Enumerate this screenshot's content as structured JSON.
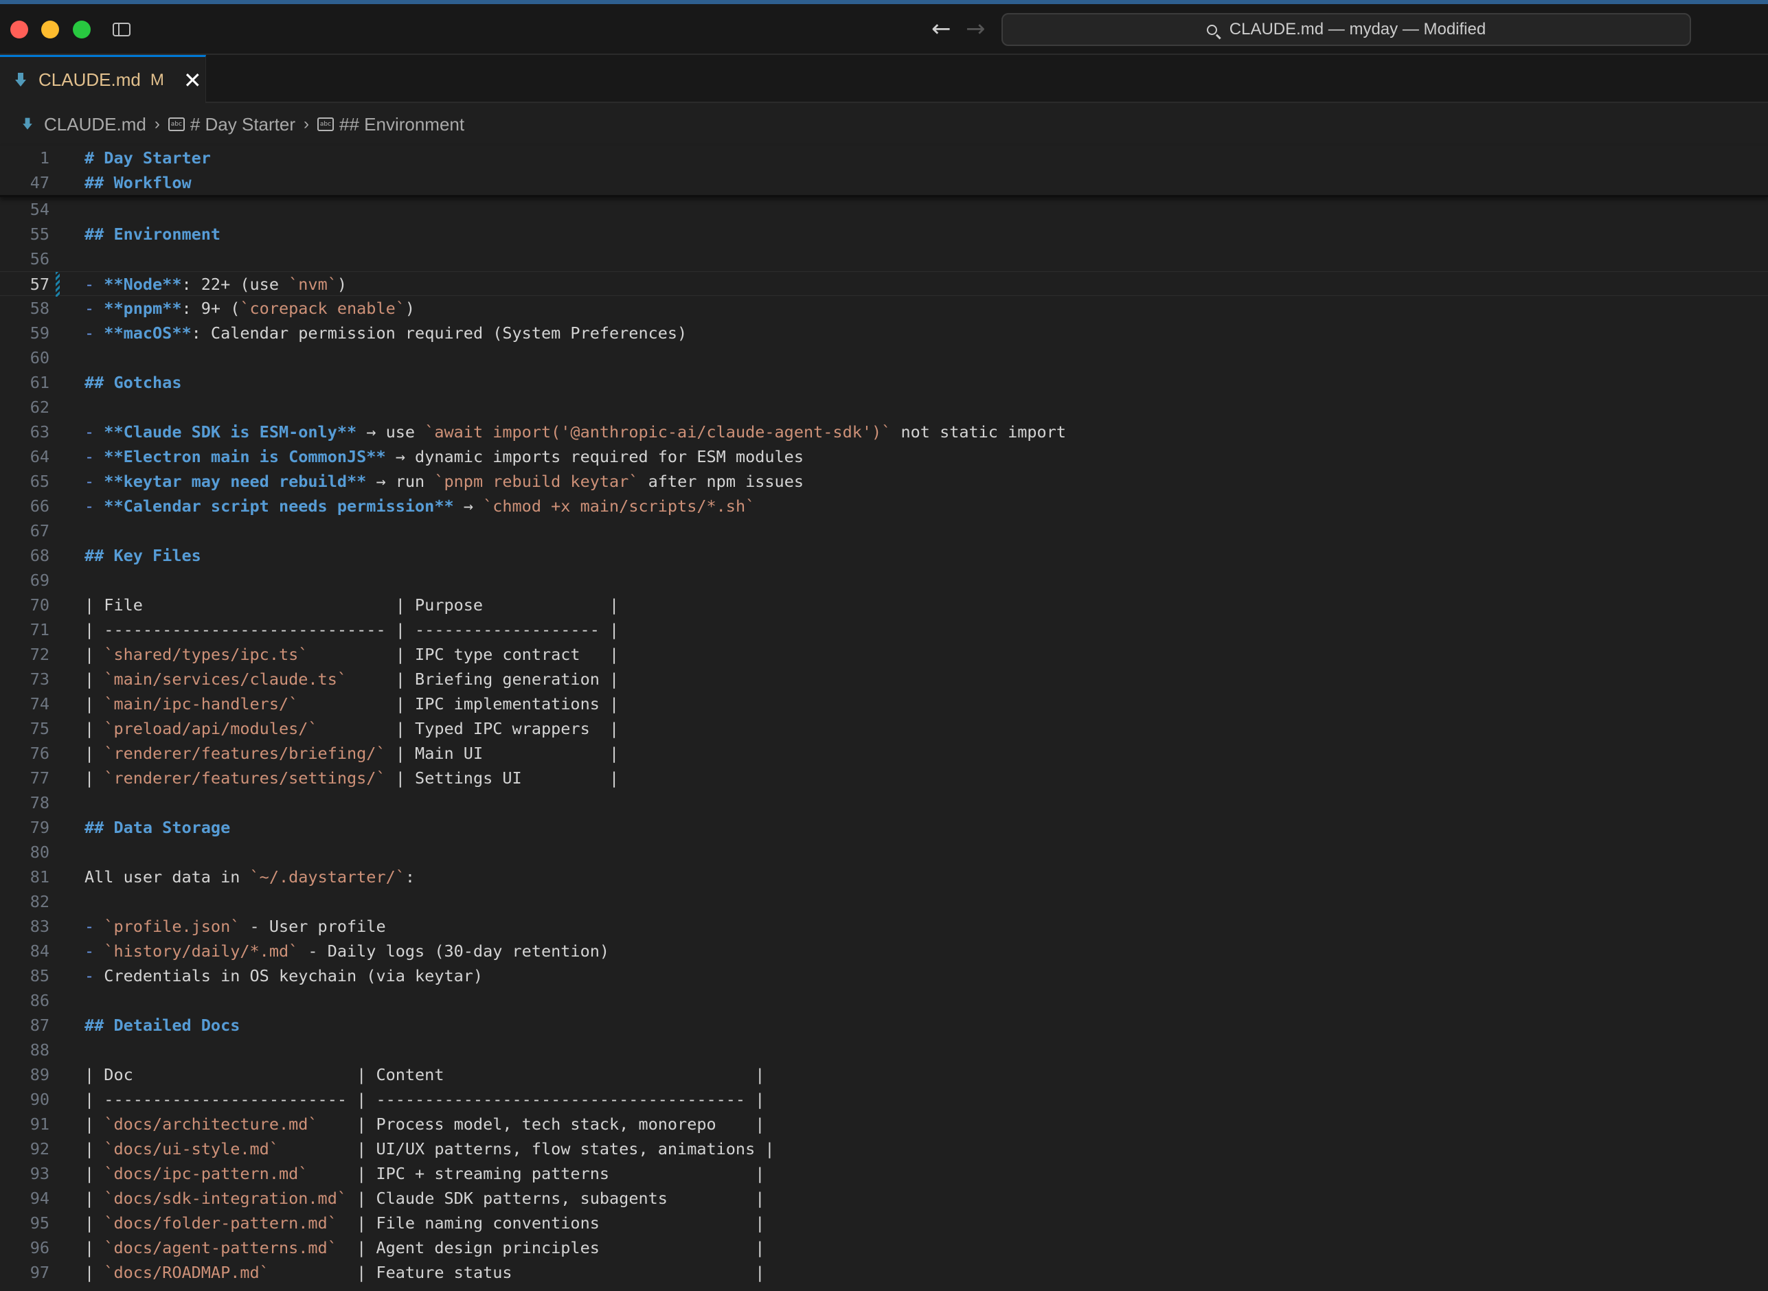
{
  "window": {
    "title": "CLAUDE.md — myday — Modified"
  },
  "tab": {
    "filename": "CLAUDE.md",
    "modified": "M"
  },
  "breadcrumb": {
    "file": "CLAUDE.md",
    "level1": "# Day Starter",
    "level2": "## Environment"
  },
  "sticky_lines": [
    {
      "num": "1",
      "segs": [
        {
          "k": "h",
          "t": "# Day Starter"
        }
      ]
    },
    {
      "num": "47",
      "segs": [
        {
          "k": "h",
          "t": "## Workflow"
        }
      ]
    }
  ],
  "lines": [
    {
      "num": "54",
      "segs": []
    },
    {
      "num": "55",
      "segs": [
        {
          "k": "h",
          "t": "## Environment"
        }
      ]
    },
    {
      "num": "56",
      "segs": []
    },
    {
      "num": "57",
      "active": true,
      "segs": [
        {
          "k": "p",
          "t": "- "
        },
        {
          "k": "b",
          "t": "**Node**"
        },
        {
          "k": "t",
          "t": ": 22+ (use "
        },
        {
          "k": "c",
          "t": "`nvm`"
        },
        {
          "k": "t",
          "t": ")"
        }
      ]
    },
    {
      "num": "58",
      "segs": [
        {
          "k": "p",
          "t": "- "
        },
        {
          "k": "b",
          "t": "**pnpm**"
        },
        {
          "k": "t",
          "t": ": 9+ ("
        },
        {
          "k": "c",
          "t": "`corepack enable`"
        },
        {
          "k": "t",
          "t": ")"
        }
      ]
    },
    {
      "num": "59",
      "segs": [
        {
          "k": "p",
          "t": "- "
        },
        {
          "k": "b",
          "t": "**macOS**"
        },
        {
          "k": "t",
          "t": ": Calendar permission required (System Preferences)"
        }
      ]
    },
    {
      "num": "60",
      "segs": []
    },
    {
      "num": "61",
      "segs": [
        {
          "k": "h",
          "t": "## Gotchas"
        }
      ]
    },
    {
      "num": "62",
      "segs": []
    },
    {
      "num": "63",
      "segs": [
        {
          "k": "p",
          "t": "- "
        },
        {
          "k": "b",
          "t": "**Claude SDK is ESM-only**"
        },
        {
          "k": "t",
          "t": " → use "
        },
        {
          "k": "c",
          "t": "`await import('@anthropic-ai/claude-agent-sdk')`"
        },
        {
          "k": "t",
          "t": " not static import"
        }
      ]
    },
    {
      "num": "64",
      "segs": [
        {
          "k": "p",
          "t": "- "
        },
        {
          "k": "b",
          "t": "**Electron main is CommonJS**"
        },
        {
          "k": "t",
          "t": " → dynamic imports required for ESM modules"
        }
      ]
    },
    {
      "num": "65",
      "segs": [
        {
          "k": "p",
          "t": "- "
        },
        {
          "k": "b",
          "t": "**keytar may need rebuild**"
        },
        {
          "k": "t",
          "t": " → run "
        },
        {
          "k": "c",
          "t": "`pnpm rebuild keytar`"
        },
        {
          "k": "t",
          "t": " after npm issues"
        }
      ]
    },
    {
      "num": "66",
      "segs": [
        {
          "k": "p",
          "t": "- "
        },
        {
          "k": "b",
          "t": "**Calendar script needs permission**"
        },
        {
          "k": "t",
          "t": " → "
        },
        {
          "k": "c",
          "t": "`chmod +x main/scripts/*.sh`"
        }
      ]
    },
    {
      "num": "67",
      "segs": []
    },
    {
      "num": "68",
      "segs": [
        {
          "k": "h",
          "t": "## Key Files"
        }
      ]
    },
    {
      "num": "69",
      "segs": []
    },
    {
      "num": "70",
      "segs": [
        {
          "k": "t",
          "t": "| File                          | Purpose             |"
        }
      ]
    },
    {
      "num": "71",
      "segs": [
        {
          "k": "t",
          "t": "| ----------------------------- | ------------------- |"
        }
      ]
    },
    {
      "num": "72",
      "segs": [
        {
          "k": "t",
          "t": "| "
        },
        {
          "k": "c",
          "t": "`shared/types/ipc.ts`"
        },
        {
          "k": "t",
          "t": "         | IPC type contract   |"
        }
      ]
    },
    {
      "num": "73",
      "segs": [
        {
          "k": "t",
          "t": "| "
        },
        {
          "k": "c",
          "t": "`main/services/claude.ts`"
        },
        {
          "k": "t",
          "t": "     | Briefing generation |"
        }
      ]
    },
    {
      "num": "74",
      "segs": [
        {
          "k": "t",
          "t": "| "
        },
        {
          "k": "c",
          "t": "`main/ipc-handlers/`"
        },
        {
          "k": "t",
          "t": "          | IPC implementations |"
        }
      ]
    },
    {
      "num": "75",
      "segs": [
        {
          "k": "t",
          "t": "| "
        },
        {
          "k": "c",
          "t": "`preload/api/modules/`"
        },
        {
          "k": "t",
          "t": "        | Typed IPC wrappers  |"
        }
      ]
    },
    {
      "num": "76",
      "segs": [
        {
          "k": "t",
          "t": "| "
        },
        {
          "k": "c",
          "t": "`renderer/features/briefing/`"
        },
        {
          "k": "t",
          "t": " | Main UI             |"
        }
      ]
    },
    {
      "num": "77",
      "segs": [
        {
          "k": "t",
          "t": "| "
        },
        {
          "k": "c",
          "t": "`renderer/features/settings/`"
        },
        {
          "k": "t",
          "t": " | Settings UI         |"
        }
      ]
    },
    {
      "num": "78",
      "segs": []
    },
    {
      "num": "79",
      "segs": [
        {
          "k": "h",
          "t": "## Data Storage"
        }
      ]
    },
    {
      "num": "80",
      "segs": []
    },
    {
      "num": "81",
      "segs": [
        {
          "k": "t",
          "t": "All user data in "
        },
        {
          "k": "c",
          "t": "`~/.daystarter/`"
        },
        {
          "k": "t",
          "t": ":"
        }
      ]
    },
    {
      "num": "82",
      "segs": []
    },
    {
      "num": "83",
      "segs": [
        {
          "k": "p",
          "t": "- "
        },
        {
          "k": "c",
          "t": "`profile.json`"
        },
        {
          "k": "t",
          "t": " - User profile"
        }
      ]
    },
    {
      "num": "84",
      "segs": [
        {
          "k": "p",
          "t": "- "
        },
        {
          "k": "c",
          "t": "`history/daily/*.md`"
        },
        {
          "k": "t",
          "t": " - Daily logs (30-day retention)"
        }
      ]
    },
    {
      "num": "85",
      "segs": [
        {
          "k": "p",
          "t": "- "
        },
        {
          "k": "t",
          "t": "Credentials in OS keychain (via keytar)"
        }
      ]
    },
    {
      "num": "86",
      "segs": []
    },
    {
      "num": "87",
      "segs": [
        {
          "k": "h",
          "t": "## Detailed Docs"
        }
      ]
    },
    {
      "num": "88",
      "segs": []
    },
    {
      "num": "89",
      "segs": [
        {
          "k": "t",
          "t": "| Doc                       | Content                                |"
        }
      ]
    },
    {
      "num": "90",
      "segs": [
        {
          "k": "t",
          "t": "| ------------------------- | -------------------------------------- |"
        }
      ]
    },
    {
      "num": "91",
      "segs": [
        {
          "k": "t",
          "t": "| "
        },
        {
          "k": "c",
          "t": "`docs/architecture.md`"
        },
        {
          "k": "t",
          "t": "    | Process model, tech stack, monorepo    |"
        }
      ]
    },
    {
      "num": "92",
      "segs": [
        {
          "k": "t",
          "t": "| "
        },
        {
          "k": "c",
          "t": "`docs/ui-style.md`"
        },
        {
          "k": "t",
          "t": "        | UI/UX patterns, flow states, animations |"
        }
      ]
    },
    {
      "num": "93",
      "segs": [
        {
          "k": "t",
          "t": "| "
        },
        {
          "k": "c",
          "t": "`docs/ipc-pattern.md`"
        },
        {
          "k": "t",
          "t": "     | IPC + streaming patterns               |"
        }
      ]
    },
    {
      "num": "94",
      "segs": [
        {
          "k": "t",
          "t": "| "
        },
        {
          "k": "c",
          "t": "`docs/sdk-integration.md`"
        },
        {
          "k": "t",
          "t": " | Claude SDK patterns, subagents         |"
        }
      ]
    },
    {
      "num": "95",
      "segs": [
        {
          "k": "t",
          "t": "| "
        },
        {
          "k": "c",
          "t": "`docs/folder-pattern.md`"
        },
        {
          "k": "t",
          "t": "  | File naming conventions                |"
        }
      ]
    },
    {
      "num": "96",
      "segs": [
        {
          "k": "t",
          "t": "| "
        },
        {
          "k": "c",
          "t": "`docs/agent-patterns.md`"
        },
        {
          "k": "t",
          "t": "  | Agent design principles                |"
        }
      ]
    },
    {
      "num": "97",
      "segs": [
        {
          "k": "t",
          "t": "| "
        },
        {
          "k": "c",
          "t": "`docs/ROADMAP.md`"
        },
        {
          "k": "t",
          "t": "         | Feature status                         |"
        }
      ]
    }
  ]
}
